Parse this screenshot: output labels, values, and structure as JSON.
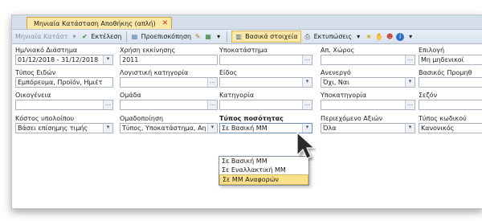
{
  "tab": {
    "title": "Μηνιαία Κατάσταση Αποθήκης (απλή)",
    "close": "✕"
  },
  "toolbar": {
    "view_name": "Μηνιαία Κατάστ",
    "execute": "Εκτέλεση",
    "preview": "Προεπισκόπηση",
    "basic": "Βασικά στοιχεία",
    "prints": "Εκτυπώσεις"
  },
  "form": {
    "period": {
      "label": "Ημ/νιακό Διάστημα",
      "value": "01/12/2018 - 31/12/2018"
    },
    "year": {
      "label": "Χρήση εκκίνησης",
      "value": "2011"
    },
    "branch": {
      "label": "Υποκατάστημα",
      "value": ""
    },
    "warehouse": {
      "label": "Απ. Χώρος",
      "value": ""
    },
    "option": {
      "label": "Επιλογή",
      "value": "Μη μηδενικοί"
    },
    "item_type": {
      "label": "Τύπος Ειδών",
      "value": "Εμπόρευμα, Προϊόν, Ημιέτ"
    },
    "accounting": {
      "label": "Λογιστική κατηγορία",
      "value": ""
    },
    "item": {
      "label": "Είδος",
      "value": ""
    },
    "inactive": {
      "label": "Ανενεργό",
      "value": "Όχι, Ναι"
    },
    "supplier": {
      "label": "Βασικός Προμηθ",
      "value": ""
    },
    "family": {
      "label": "Οικογένεια",
      "value": ""
    },
    "group": {
      "label": "Ομάδα",
      "value": ""
    },
    "category": {
      "label": "Κατηγορία",
      "value": ""
    },
    "subcategory": {
      "label": "Υποκατηγορία",
      "value": ""
    },
    "season": {
      "label": "Σεζόν",
      "value": ""
    },
    "cost": {
      "label": "Κόστος υπολοίπου",
      "value": "Βάσει επίσημης τιμής"
    },
    "grouping": {
      "label": "Ομαδοποίηση",
      "value": "Τύπος, Υποκατάστημα, Αη"
    },
    "qty_type": {
      "label": "Τύπος ποσότητας",
      "value": "Σε Βασική ΜΜ"
    },
    "values": {
      "label": "Περιεχόμενο Αξιών",
      "value": "Όλα"
    },
    "code_type": {
      "label": "Τύπος κωδικού",
      "value": "Κανονικός"
    }
  },
  "dropdown": {
    "options": [
      "Σε Βασική ΜΜ",
      "Σε Εναλλακτική ΜΜ",
      "Σε ΜΜ Αναφορών"
    ],
    "highlighted": 2
  }
}
